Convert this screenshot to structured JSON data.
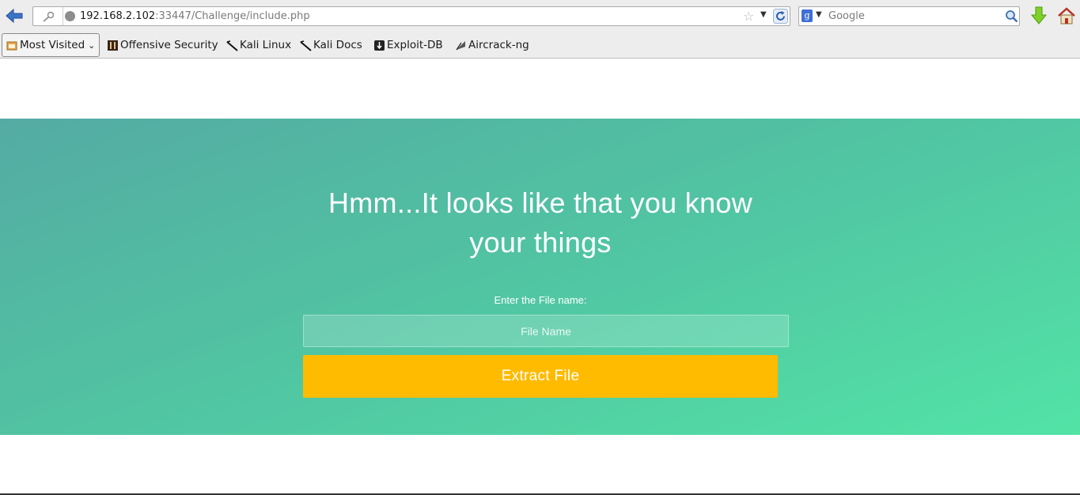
{
  "browser": {
    "url": {
      "host": "192.168.2.102",
      "rest": ":33447/Challenge/include.php"
    },
    "search": {
      "placeholder": "Google",
      "engine_glyph": "g"
    },
    "icons": [
      "back-arrow-icon",
      "site-identity-icon",
      "globe-icon",
      "bookmark-star-icon",
      "dropdown-icon",
      "reload-icon",
      "search-engine-icon",
      "magnifier-icon",
      "download-arrow-icon",
      "home-icon"
    ]
  },
  "bookmarks": {
    "most_visited": "Most Visited",
    "items": [
      {
        "label": "Offensive Security",
        "icon": "offsec-icon"
      },
      {
        "label": "Kali Linux",
        "icon": "kali-dragon-icon"
      },
      {
        "label": "Kali Docs",
        "icon": "kali-dragon-icon"
      },
      {
        "label": "Exploit-DB",
        "icon": "exploitdb-icon"
      },
      {
        "label": "Aircrack-ng",
        "icon": "aircrack-icon"
      }
    ]
  },
  "page": {
    "title_line1": "Hmm...It looks like that you know",
    "title_line2": "your things",
    "field_label": "Enter the File name:",
    "input_placeholder": "File Name",
    "input_value": "",
    "button_label": "Extract File",
    "colors": {
      "button": "#ffbb00",
      "gradient_start": "#54aba3",
      "gradient_end": "#52e3a6"
    }
  }
}
